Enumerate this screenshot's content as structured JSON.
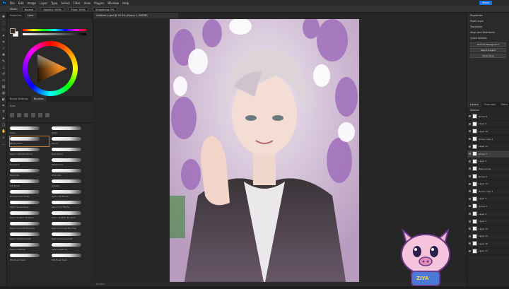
{
  "menubar": {
    "items": [
      "File",
      "Edit",
      "Image",
      "Layer",
      "Type",
      "Select",
      "Filter",
      "View",
      "Plugins",
      "Window",
      "Help"
    ],
    "share": "Share"
  },
  "options": {
    "mode_label": "Mode:",
    "mode_value": "Normal",
    "opacity": "Opacity: 100%",
    "flow": "Flow: 100%",
    "smoothing": "Smoothing: 0%"
  },
  "left": {
    "color_tabs": [
      "Swatches",
      "Color"
    ],
    "brush_tabs": [
      "Brush Settings",
      "Brushes"
    ],
    "size": "Size:",
    "brushes": [
      {
        "name": "Spiky"
      },
      {
        "name": "Spiky"
      },
      {
        "name": "NB Brushes",
        "selected": true
      },
      {
        "name": "Pencil"
      },
      {
        "name": "Kyle's Ultimate Pencil"
      },
      {
        "name": "Kyle Pencil"
      },
      {
        "name": "Gouache"
      },
      {
        "name": "Watercolor"
      },
      {
        "name": "Real Oils"
      },
      {
        "name": "Charcoal"
      },
      {
        "name": "Ink Brush"
      },
      {
        "name": "Spatter"
      },
      {
        "name": "Background brush"
      },
      {
        "name": "Kyle's Tilt Brush"
      },
      {
        "name": "Kyle's Screentone"
      },
      {
        "name": "Kyle's Dry Media"
      },
      {
        "name": "Kyle's Spatter Brushes"
      },
      {
        "name": "Kyle's Spatter Brushes"
      },
      {
        "name": "Kyle's Concept Brushes"
      },
      {
        "name": "Kyle's Concept Brushes"
      },
      {
        "name": "Kyle's Impressionist"
      },
      {
        "name": "Kyle's Impressionist"
      },
      {
        "name": "Kyle's Halftone"
      },
      {
        "name": "Kyle's Halftone"
      },
      {
        "name": "MB Brush Pack"
      },
      {
        "name": "MB Brush Pack"
      }
    ]
  },
  "document": {
    "tab": "Untitled-1.psd @ 33.3% (Group 1, RGB/8)",
    "status": "33.33%"
  },
  "right": {
    "properties_title": "Properties",
    "pixel_layer": "Pixel Layer",
    "transform": "Transform",
    "align": "Align and Distribute",
    "quick_actions": "Quick Actions",
    "actions": [
      "Remove Background",
      "Select Subject",
      "Show More"
    ],
    "layers_tabs": [
      "Layers",
      "Channels",
      "Paths"
    ],
    "blend": "Normal",
    "layers": [
      {
        "name": "Group 9"
      },
      {
        "name": "Layer 6"
      },
      {
        "name": "Layer 10"
      },
      {
        "name": "Group copy 2"
      },
      {
        "name": "Layer 11"
      },
      {
        "name": "Group 7",
        "selected": true
      },
      {
        "name": "Layer 3"
      },
      {
        "name": "Base Group"
      },
      {
        "name": "Group 2"
      },
      {
        "name": "Layer 13"
      },
      {
        "name": "Group copy 1"
      },
      {
        "name": "Layer 4"
      },
      {
        "name": "Group 5"
      },
      {
        "name": "Layer 2"
      },
      {
        "name": "Layer 1"
      },
      {
        "name": "Layer 14"
      },
      {
        "name": "Layer 15"
      },
      {
        "name": "Layer 16"
      },
      {
        "name": "Layer 17"
      }
    ]
  },
  "mascot": {
    "label": "ZIYA"
  }
}
